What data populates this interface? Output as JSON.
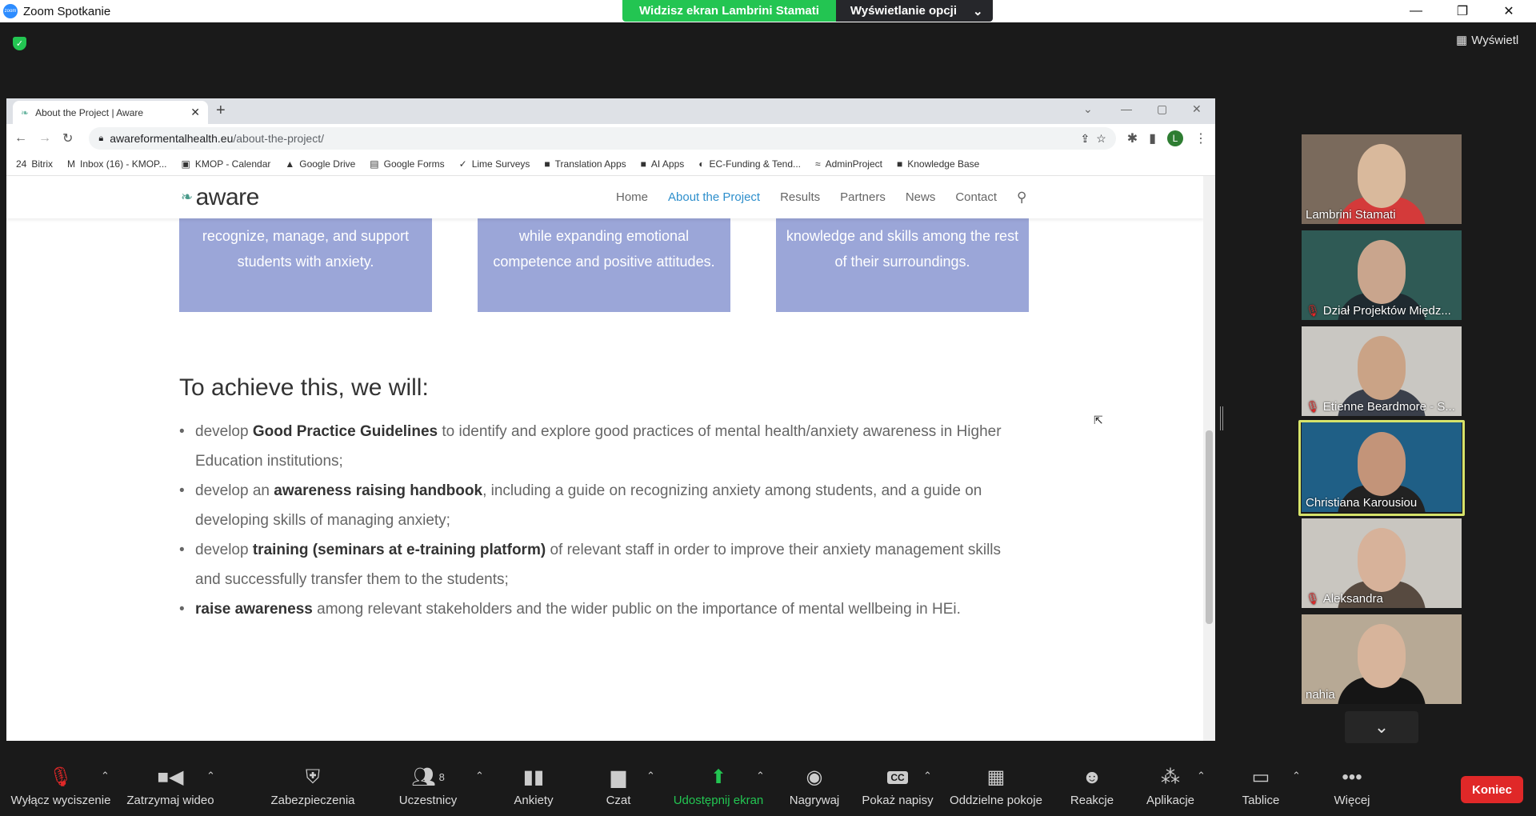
{
  "zoom": {
    "title": "Zoom Spotkanie",
    "logo_text": "zoom",
    "share_banner": "Widzisz ekran Lambrini Stamati",
    "view_options": "Wyświetlanie opcji",
    "view_button": "Wyświetl"
  },
  "browser": {
    "tab_title": "About the Project | Aware",
    "url_domain": "awareformentalhealth.eu",
    "url_path": "/about-the-project/",
    "profile_initial": "L",
    "bookmarks": [
      {
        "icon": "24",
        "label": "Bitrix"
      },
      {
        "icon": "M",
        "label": "Inbox (16) - KMOP..."
      },
      {
        "icon": "▣",
        "label": "KMOP - Calendar"
      },
      {
        "icon": "▲",
        "label": "Google Drive"
      },
      {
        "icon": "▤",
        "label": "Google Forms"
      },
      {
        "icon": "✓",
        "label": "Lime Surveys"
      },
      {
        "icon": "■",
        "label": "Translation Apps"
      },
      {
        "icon": "■",
        "label": "AI Apps"
      },
      {
        "icon": "◐",
        "label": "EC-Funding & Tend..."
      },
      {
        "icon": "≈",
        "label": "AdminProject"
      },
      {
        "icon": "■",
        "label": "Knowledge Base"
      }
    ]
  },
  "site": {
    "logo": "aware",
    "nav": [
      "Home",
      "About the Project",
      "Results",
      "Partners",
      "News",
      "Contact"
    ],
    "active_nav": "About the Project",
    "cards": [
      {
        "line1": "recognize, manage, and support",
        "line2": "students with anxiety."
      },
      {
        "line1": "while expanding emotional",
        "line2": "competence and positive attitudes."
      },
      {
        "line1": "knowledge and skills among the rest",
        "line2": "of their surroundings."
      }
    ],
    "heading": "To achieve this, we will:",
    "bullets": [
      {
        "pre": "develop ",
        "bold": "Good Practice Guidelines",
        "post": " to identify and explore good practices of mental health/anxiety awareness in Higher Education institutions;"
      },
      {
        "pre": "develop an ",
        "bold": "awareness raising handbook",
        "post": ", including a guide on recognizing anxiety among students, and a guide on developing skills of managing anxiety;"
      },
      {
        "pre": "develop ",
        "bold": "training (seminars at e-training platform)",
        "post": " of relevant staff in order to improve their anxiety management skills and successfully transfer them to the students;"
      },
      {
        "pre": "",
        "bold": "raise awareness",
        "post": " among relevant stakeholders and the wider public on the importance of mental wellbeing in HEi."
      }
    ]
  },
  "participants": [
    {
      "name": "Lambrini Stamati",
      "muted": false,
      "bg": "#7a6a5c",
      "face": "#d9b99c",
      "shirt": "#d43a3a"
    },
    {
      "name": "Dział Projektów Międz...",
      "muted": true,
      "bg": "#2f5a55",
      "face": "#c9a58d",
      "shirt": "#1f2a30"
    },
    {
      "name": "Etienne Beardmore - S...",
      "muted": true,
      "bg": "#c9c7c2",
      "face": "#caa386",
      "shirt": "#3a3f4a"
    },
    {
      "name": "Christiana Karousiou",
      "muted": false,
      "bg": "#1f5f86",
      "face": "#c39479",
      "shirt": "#222"
    },
    {
      "name": "Aleksandra",
      "muted": true,
      "bg": "#c9c6c0",
      "face": "#d7b29a",
      "shirt": "#574a40"
    },
    {
      "name": "nahia",
      "muted": false,
      "bg": "#b7a995",
      "face": "#d7b49b",
      "shirt": "#151515"
    }
  ],
  "toolbar": {
    "unmute": "Wyłącz wyciszenie",
    "stop_video": "Zatrzymaj wideo",
    "security": "Zabezpieczenia",
    "participants": "Uczestnicy",
    "participants_count": "8",
    "polls": "Ankiety",
    "chat": "Czat",
    "share": "Udostępnij ekran",
    "record": "Nagrywaj",
    "captions": "Pokaż napisy",
    "captions_icon": "CC",
    "breakout": "Oddzielne pokoje",
    "reactions": "Reakcje",
    "apps": "Aplikacje",
    "whiteboards": "Tablice",
    "more": "Więcej",
    "end": "Koniec"
  },
  "colors": {
    "zoom_green": "#23c552",
    "end_red": "#e02828",
    "card_blue": "#9ba6d8",
    "active_link": "#2e8fcc",
    "speaker_border": "#d6e36a"
  }
}
